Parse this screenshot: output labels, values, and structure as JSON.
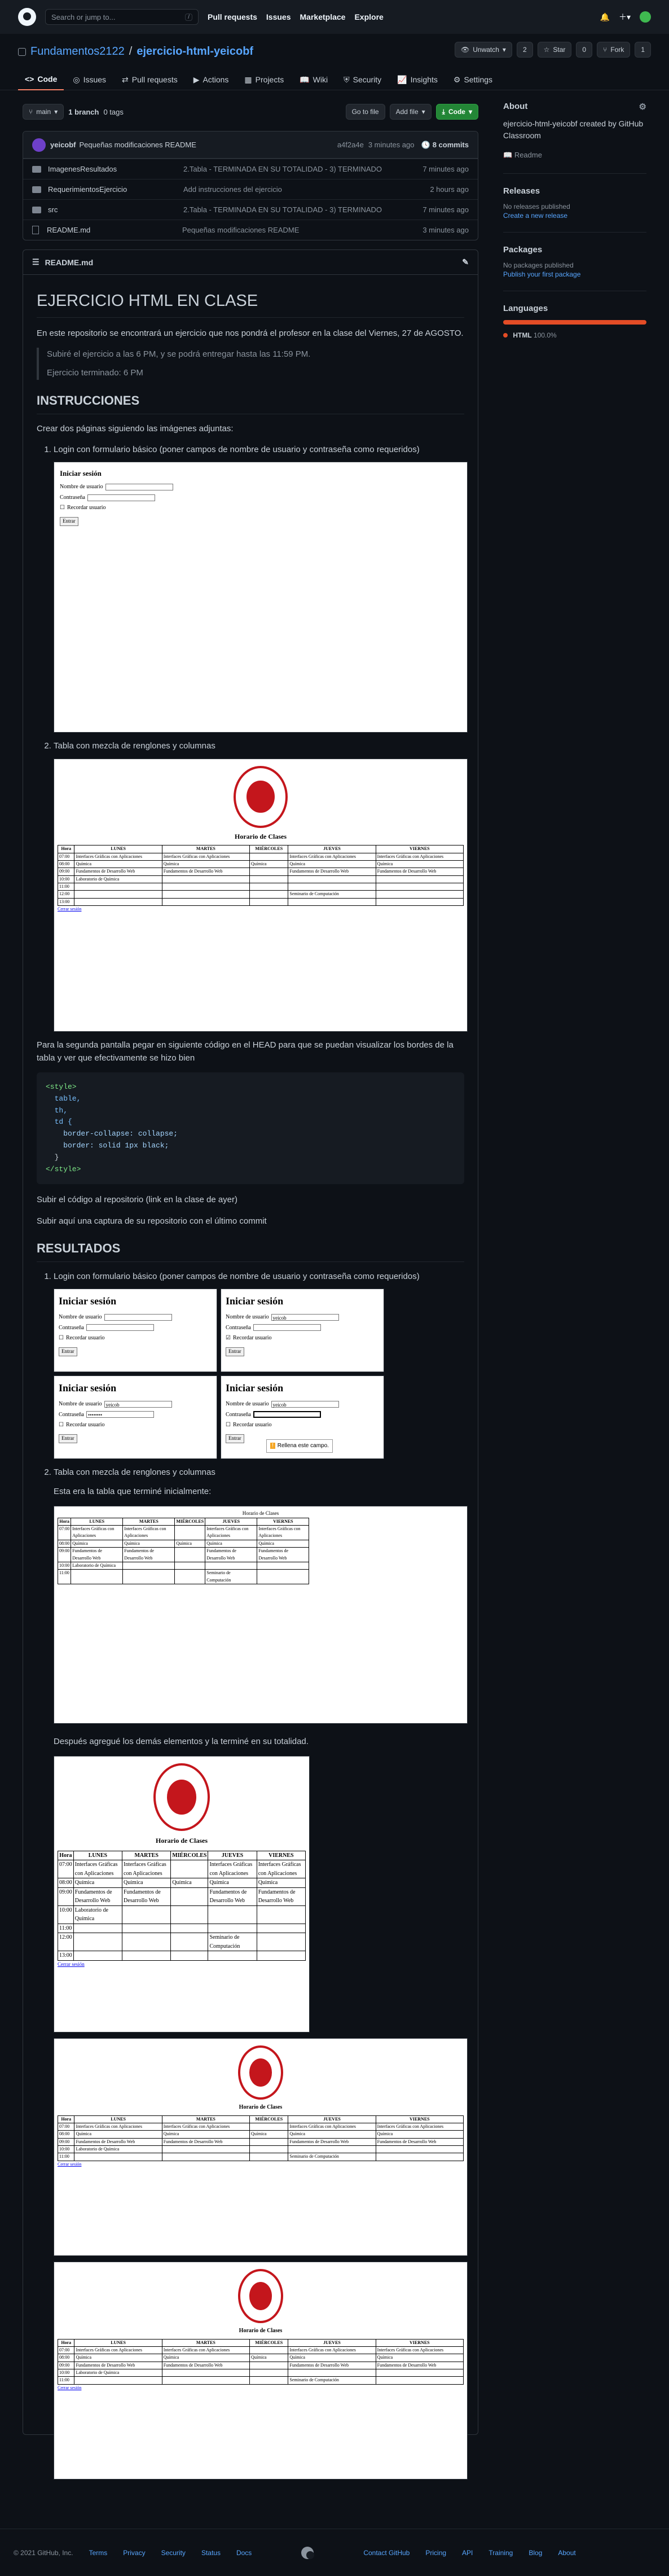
{
  "header": {
    "search_placeholder": "Search or jump to...",
    "slash": "/",
    "nav": [
      "Pull requests",
      "Issues",
      "Marketplace",
      "Explore"
    ]
  },
  "repo": {
    "owner": "Fundamentos2122",
    "separator": "/",
    "name": "ejercicio-html-yeicobf",
    "badge": "Public"
  },
  "actions": {
    "unwatch": "Unwatch",
    "unwatch_count": "2",
    "star": "Star",
    "star_count": "0",
    "fork": "Fork",
    "fork_count": "1"
  },
  "tabs": [
    "Code",
    "Issues",
    "Pull requests",
    "Actions",
    "Projects",
    "Wiki",
    "Security",
    "Insights",
    "Settings"
  ],
  "toolbar": {
    "branch": "main",
    "branches": "1 branch",
    "tags": "0 tags",
    "goto": "Go to file",
    "add": "Add file",
    "code": "Code"
  },
  "commit": {
    "user": "yeicobf",
    "message": "Pequeñas modificaciones README",
    "hash": "a4f2a4e",
    "time": "3 minutes ago",
    "count": "8 commits"
  },
  "files": [
    {
      "name": "ImagenesResultados",
      "msg": "2.Tabla - TERMINADA EN SU TOTALIDAD - 3) TERMINADO",
      "time": "7 minutes ago",
      "type": "folder"
    },
    {
      "name": "RequerimientosEjercicio",
      "msg": "Add instrucciones del ejercicio",
      "time": "2 hours ago",
      "type": "folder"
    },
    {
      "name": "src",
      "msg": "2.Tabla - TERMINADA EN SU TOTALIDAD - 3) TERMINADO",
      "time": "7 minutes ago",
      "type": "folder"
    },
    {
      "name": "README.md",
      "msg": "Pequeñas modificaciones README",
      "time": "3 minutes ago",
      "type": "file"
    }
  ],
  "readme": {
    "file": "README.md",
    "h1": "EJERCICIO HTML EN CLASE",
    "intro": "En este repositorio se encontrará un ejercicio que nos pondrá el profesor en la clase del Viernes, 27 de AGOSTO.",
    "quote1": "Subiré el ejercicio a las 6 PM, y se podrá entregar hasta las 11:59 PM.",
    "quote2": "Ejercicio terminado: 6 PM",
    "h2a": "INSTRUCCIONES",
    "crear": "Crear dos páginas siguiendo las imágenes adjuntas:",
    "item1": "Login con formulario básico (poner campos de nombre de usuario y contraseña como requeridos)",
    "item2": "Tabla con mezcla de renglones y columnas",
    "para_hint": "Para la segunda pantalla pegar en siguiente código en el HEAD para que se puedan visualizar los bordes de la tabla y ver que efectivamente se hizo bien",
    "code": [
      "<style>",
      "  table,",
      "  th,",
      "  td {",
      "    border-collapse: collapse;",
      "    border: solid 1px black;",
      "  }",
      "</style>"
    ],
    "subir1": "Subir el código al repositorio (link en la clase de ayer)",
    "subir2": "Subir aquí una captura de su repositorio con el último commit",
    "h2b": "RESULTADOS",
    "r_item1": "Login con formulario básico (poner campos de nombre de usuario y contraseña como requeridos)",
    "r_item2": "Tabla con mezcla de renglones y columnas",
    "r_text1": "Esta era la tabla que terminé inicialmente:",
    "r_text2": "Después agregué los demás elementos y la terminé en su totalidad."
  },
  "mock": {
    "login_title": "Iniciar sesión",
    "user_label": "Nombre de usuario",
    "pass_label": "Contraseña",
    "remember": "Recordar usuario",
    "enter": "Entrar",
    "user_value": "yeicob",
    "pass_mask": "••••••••",
    "tooltip": "Rellena este campo.",
    "horario": "Horario de Clases",
    "hora": "Hora",
    "days": [
      "LUNES",
      "MARTES",
      "MIÉRCOLES",
      "JUEVES",
      "VIERNES"
    ],
    "r1": [
      "Interfaces Gráficas con Aplicaciones",
      "Interfaces Gráficas con Aplicaciones",
      "",
      "Interfaces Gráficas con Aplicaciones",
      "Interfaces Gráficas con Aplicaciones"
    ],
    "r2": [
      "Química",
      "Química",
      "Química",
      "Química",
      "Química"
    ],
    "r3": [
      "Fundamentos de Desarrollo Web",
      "Fundamentos de Desarrollo Web",
      "",
      "Fundamentos de Desarrollo Web",
      "Fundamentos de Desarrollo Web"
    ],
    "lab": "Laboratorio de Química",
    "sem": "Seminario de Computación",
    "hours": [
      "07:00",
      "08:00",
      "09:00",
      "10:00",
      "11:00",
      "12:00",
      "13:00"
    ],
    "cerrar": "Cerrar sesión"
  },
  "sidebar": {
    "about": "About",
    "desc": "ejercicio-html-yeicobf created by GitHub Classroom",
    "readme": "Readme",
    "releases": "Releases",
    "no_releases": "No releases published",
    "create_release": "Create a new release",
    "packages": "Packages",
    "no_packages": "No packages published",
    "publish_pkg": "Publish your first package",
    "languages": "Languages",
    "lang": "HTML",
    "lang_pct": "100.0%",
    "lang_color": "#e34c26"
  },
  "footer": [
    "© 2021 GitHub, Inc.",
    "Terms",
    "Privacy",
    "Security",
    "Status",
    "Docs",
    "Contact GitHub",
    "Pricing",
    "API",
    "Training",
    "Blog",
    "About"
  ]
}
